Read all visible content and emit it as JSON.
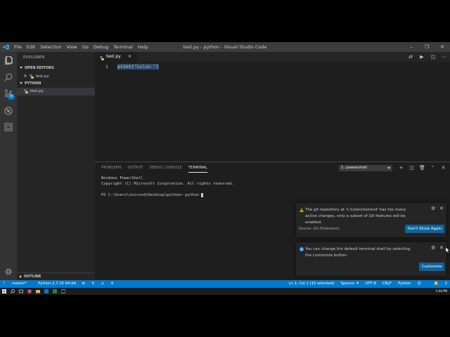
{
  "window": {
    "title": "test.py - python - Visual Studio Code",
    "menu": [
      "File",
      "Edit",
      "Selection",
      "View",
      "Go",
      "Debug",
      "Terminal",
      "Help"
    ]
  },
  "activity_bar": {
    "scm_badge": "5K"
  },
  "sidebar": {
    "title": "EXPLORER",
    "open_editors_label": "OPEN EDITORS",
    "open_editor_file": "test.py",
    "folder_label": "PYTHON",
    "folder_file": "test.py",
    "outline_label": "OUTLINE"
  },
  "editor": {
    "tab_label": "test.py",
    "line_number": "1",
    "code_fn": "print",
    "code_open": "(",
    "code_str": "\"Salom \"",
    "code_close": ")"
  },
  "panel": {
    "tabs": [
      "PROBLEMS",
      "OUTPUT",
      "DEBUG CONSOLE",
      "TERMINAL"
    ],
    "active_tab": "TERMINAL",
    "terminal_selector": "1: powershell",
    "terminal_lines": [
      "Windows PowerShell",
      "Copyright (C) Microsoft Corporation. All rights reserved.",
      "",
      "PS C:\\Users\\toirovd\\Desktop\\python> python "
    ]
  },
  "notifications": [
    {
      "type": "warning",
      "message": "The git repository at 'c:\\Users\\toirovd' has too many active changes, only a subset of Git features will be enabled.",
      "source": "Source: Git (Extension)",
      "button": "Don't Show Again"
    },
    {
      "type": "info",
      "message": "You can change the default terminal shell by selecting the customize button.",
      "button": "Customize"
    }
  ],
  "statusbar": {
    "branch": "master*",
    "interpreter": "Python 2.7.15 64-bit",
    "errors": "0",
    "warnings": "0",
    "position": "Ln 1, Col 1 (15 selected)",
    "spaces": "Spaces: 4",
    "encoding": "UTF-8",
    "eol": "CRLF",
    "language": "Python",
    "notif_count": "2"
  },
  "taskbar": {
    "time": "5:44 PM"
  },
  "colors": {
    "accent": "#007acc",
    "button": "#0e639c",
    "warning": "#cca700",
    "info": "#3794ff"
  }
}
